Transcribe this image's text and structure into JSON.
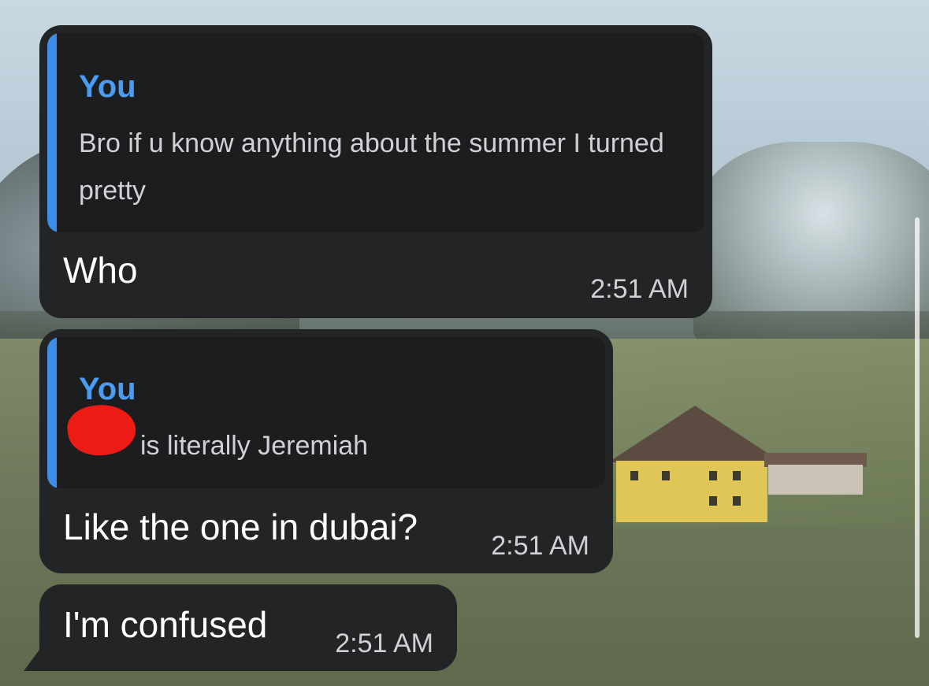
{
  "messages": [
    {
      "reply": {
        "sender": "You",
        "text": "Bro if u know anything about the summer I turned pretty"
      },
      "text": "Who",
      "time": "2:51 AM"
    },
    {
      "reply": {
        "sender": "You",
        "text": "is literally Jeremiah"
      },
      "text": "Like the one in dubai?",
      "time": "2:51 AM"
    },
    {
      "text": "I'm confused",
      "time": "2:51 AM"
    }
  ],
  "colors": {
    "bubble": "#232425",
    "quote_background": "#1c1d1e",
    "quote_accent": "#3d8ee8",
    "redaction": "#ec1b16"
  }
}
